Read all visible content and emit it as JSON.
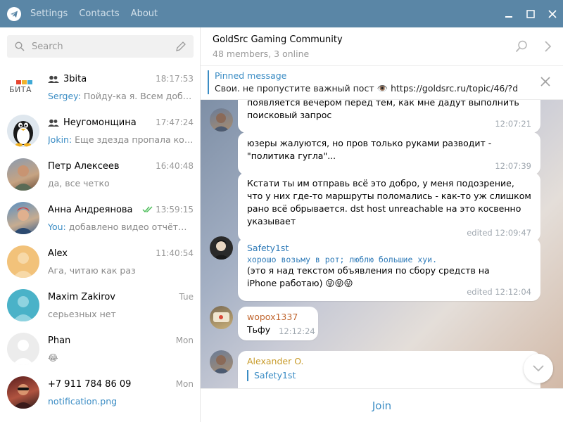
{
  "titlebar": {
    "menu": [
      "Settings",
      "Contacts",
      "About"
    ]
  },
  "search": {
    "placeholder": "Search"
  },
  "chats": [
    {
      "name": "3bita",
      "group": true,
      "time": "18:17:53",
      "sender": "Sergey:",
      "preview": " Пойду-ка я. Всем добра ...",
      "avatar": "3bita-logo",
      "avatar_text": "БИТА"
    },
    {
      "name": "Неугомонщина",
      "group": true,
      "time": "17:47:24",
      "sender": "Jokin:",
      "preview": " Еще здезда пропала когда...",
      "avatar": "penguin"
    },
    {
      "name": "Петр Алексеев",
      "group": false,
      "time": "16:40:48",
      "sender": "",
      "preview": "да, все четко",
      "avatar": "photo"
    },
    {
      "name": "Анна Андреянова",
      "group": false,
      "time": "13:59:15",
      "sender": "You:",
      "preview": " добавлено видео отчёты : ...",
      "avatar": "photo",
      "read": true
    },
    {
      "name": "Alex",
      "group": false,
      "time": "11:40:54",
      "sender": "",
      "preview": "Ага, читаю как раз",
      "avatar": "placeholder-orange"
    },
    {
      "name": "Maxim Zakirov",
      "group": false,
      "time": "Tue",
      "sender": "",
      "preview": "серьезных нет",
      "avatar": "placeholder-blue"
    },
    {
      "name": "Phan",
      "group": false,
      "time": "Mon",
      "sender": "",
      "preview": "😂",
      "avatar": "placeholder-white"
    },
    {
      "name": "+7 911 784 86 09",
      "group": false,
      "time": "Mon",
      "sender": "",
      "preview": "notification.png",
      "avatar": "photo",
      "link": true
    }
  ],
  "header": {
    "title": "GoldSrc Gaming Community",
    "subtitle": "48 members, 3 online"
  },
  "pinned": {
    "label": "Pinned message",
    "text": "Свои. не пропустите важный пост 👁️ https://goldsrc.ru/topic/46/?do..."
  },
  "messages": [
    {
      "text": "появляется вечером перед тем, как мне дадут выполнить поисковый запрос",
      "time": "12:07:21"
    },
    {
      "text": "юзеры жалуются, но пров только руками разводит - \"политика гугла\"...",
      "time": "12:07:39"
    },
    {
      "text": "Кстати ты им отправь всё это добро, у меня подозрение, что у них где-то маршруты поломались - как-то уж слишком рано всё обрывается. dst host unreachable на это косвенно указывает",
      "time": "edited 12:09:47"
    },
    {
      "author": "Safety1st",
      "mono": "хорошо возьму в рот; люблю большие хуи.",
      "text": "(это я над текстом объявления по сбору средств на iPhone работаю) 😜😝😛",
      "time": "edited 12:12:04"
    },
    {
      "author": "wopox1337",
      "text": "Тьфу",
      "time": "12:12:24"
    },
    {
      "author": "Alexander O.",
      "reply_author": "Safety1st"
    }
  ],
  "join_label": "Join",
  "colors": {
    "titlebar": "#5a86a6",
    "accent": "#3a8cc4",
    "safety_name": "#2f7bb8",
    "wopox_name": "#c0662f",
    "alexander_name": "#c89b2a",
    "read_check": "#4dbd5a"
  }
}
